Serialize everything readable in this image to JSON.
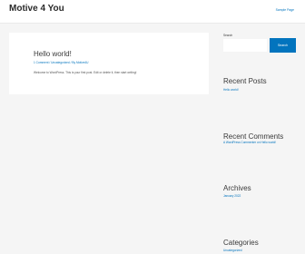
{
  "header": {
    "site_title": "Motive 4 You",
    "nav_link": "Sample Page"
  },
  "post": {
    "title": "Hello world!",
    "meta": "1 Comment / Uncategorized / By Motive4U",
    "excerpt": "Welcome to WordPress. This is your first post. Edit or delete it, then start writing!"
  },
  "sidebar": {
    "search_label": "Search",
    "search_placeholder": "",
    "search_button": "Search",
    "recent_posts": {
      "title": "Recent Posts",
      "items": [
        "Hello world!"
      ]
    },
    "recent_comments": {
      "title": "Recent Comments",
      "items": [
        "A WordPress Commenter on Hello world!"
      ]
    },
    "archives": {
      "title": "Archives",
      "items": [
        "January 2022"
      ]
    },
    "categories": {
      "title": "Categories",
      "items": [
        "Uncategorized"
      ]
    }
  },
  "colors": {
    "accent": "#0274be",
    "background": "#f5f5f5",
    "card": "#ffffff"
  }
}
